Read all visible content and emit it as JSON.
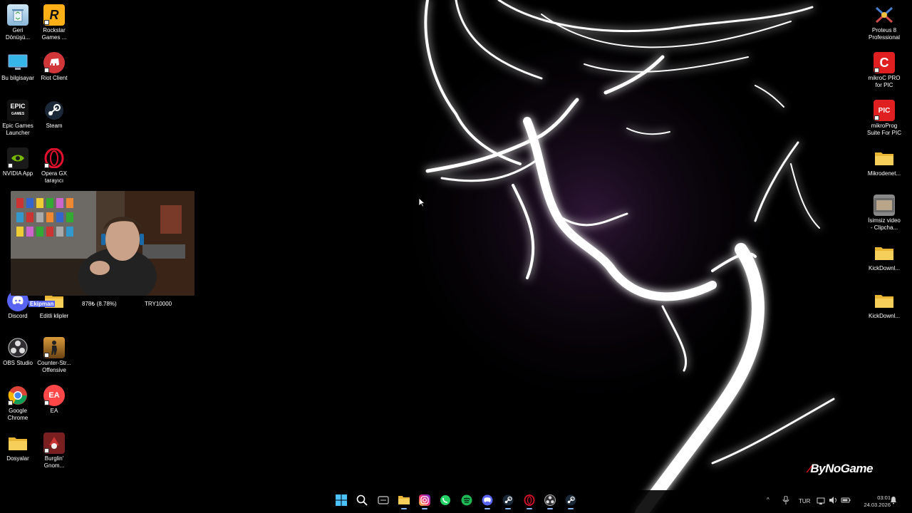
{
  "desktop": {
    "left_column_1": [
      {
        "label": "Geri Dönüşü...",
        "icon": "recycle-bin-icon"
      },
      {
        "label": "Bu bilgisayar",
        "icon": "monitor-icon"
      },
      {
        "label": "Epic Games Launcher",
        "icon": "epic-games-icon"
      },
      {
        "label": "NVIDIA App",
        "icon": "nvidia-icon"
      },
      {
        "label": "Discord",
        "icon": "discord-icon"
      },
      {
        "label": "OBS Studio",
        "icon": "obs-icon"
      },
      {
        "label": "Google Chrome",
        "icon": "chrome-icon"
      },
      {
        "label": "Dosyalar",
        "icon": "folder-icon"
      }
    ],
    "left_column_2": [
      {
        "label": "Rockstar Games ...",
        "icon": "rockstar-icon"
      },
      {
        "label": "Riot Client",
        "icon": "riot-icon"
      },
      {
        "label": "Steam",
        "icon": "steam-icon"
      },
      {
        "label": "Opera GX tarayıcı",
        "icon": "opera-gx-icon"
      },
      {
        "label": "Editli klipler",
        "icon": "folder-icon"
      },
      {
        "label": "Counter-Str... Offensive",
        "icon": "csgo-icon"
      },
      {
        "label": "EA",
        "icon": "ea-icon"
      },
      {
        "label": "Burglin' Gnom...",
        "icon": "burglin-gnomes-icon"
      }
    ],
    "right_column": [
      {
        "label": "Proteus 8 Professional",
        "icon": "proteus-icon"
      },
      {
        "label": "mikroC PRO for PIC",
        "icon": "mikroc-icon"
      },
      {
        "label": "mikroProg Suite For PIC",
        "icon": "mikroprog-icon"
      },
      {
        "label": "Mikrodenet...",
        "icon": "folder-icon"
      },
      {
        "label": "İsimsiz video - Clipcha...",
        "icon": "video-file-icon"
      },
      {
        "label": "KickDownl...",
        "icon": "folder-icon"
      },
      {
        "label": "KickDownl...",
        "icon": "folder-icon"
      }
    ]
  },
  "stream_overlay": {
    "name": "Ekipman",
    "progress": "878₺ (8.78%)",
    "goal": "TRY10000"
  },
  "watermark": "ByNoGame",
  "taskbar": {
    "apps": [
      {
        "name": "start-button",
        "icon": "windows-icon"
      },
      {
        "name": "search-button",
        "icon": "search-icon"
      },
      {
        "name": "task-view",
        "icon": "task-view-icon"
      },
      {
        "name": "file-explorer",
        "icon": "folder-icon"
      },
      {
        "name": "instagram",
        "icon": "instagram-icon"
      },
      {
        "name": "whatsapp",
        "icon": "whatsapp-icon"
      },
      {
        "name": "spotify",
        "icon": "spotify-icon"
      },
      {
        "name": "discord",
        "icon": "discord-icon"
      },
      {
        "name": "steam",
        "icon": "steam-icon"
      },
      {
        "name": "opera-gx",
        "icon": "opera-gx-icon"
      },
      {
        "name": "obs",
        "icon": "obs-icon"
      },
      {
        "name": "steam-2",
        "icon": "steam-icon"
      }
    ],
    "tray": {
      "language": "TUR",
      "time": "03:01",
      "date": "24.03.2026"
    }
  },
  "colors": {
    "taskbar_bg": "#0a0a0a",
    "accent": "#8ab4f8"
  }
}
